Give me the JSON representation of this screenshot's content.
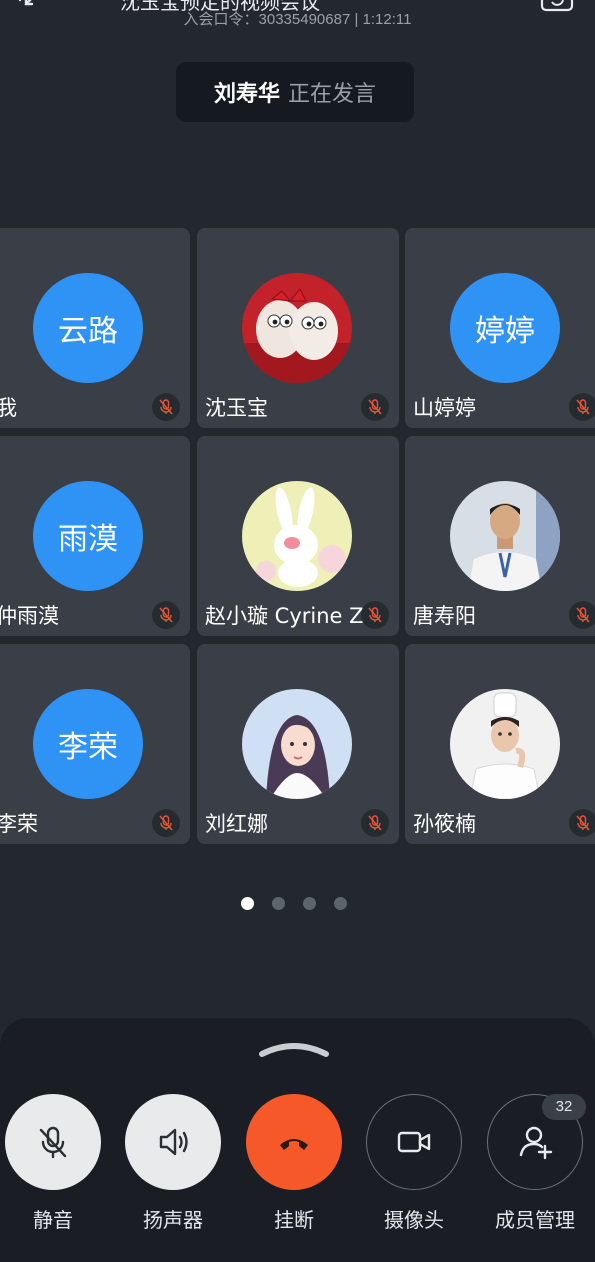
{
  "header": {
    "title_clipped": "沈玉宝预定的视频会议",
    "meeting_code": "入会口令：30335490687 | 1:12:11"
  },
  "speaker": {
    "name": "刘寿华",
    "status": "正在发言"
  },
  "participants": [
    {
      "name": "我",
      "avatar_text": "云路",
      "avatar_type": "text",
      "muted": true
    },
    {
      "name": "沈玉宝",
      "avatar_text": "",
      "avatar_type": "photo-eggs",
      "muted": true
    },
    {
      "name": "山婷婷",
      "avatar_text": "婷婷",
      "avatar_type": "text",
      "muted": true
    },
    {
      "name": "仲雨漠",
      "avatar_text": "雨漠",
      "avatar_type": "text",
      "muted": true
    },
    {
      "name": "赵小璇 Cyrine Z",
      "avatar_text": "",
      "avatar_type": "photo-rabbit",
      "muted": true
    },
    {
      "name": "唐寿阳",
      "avatar_text": "",
      "avatar_type": "photo-chef-man",
      "muted": true
    },
    {
      "name": "李荣",
      "avatar_text": "李荣",
      "avatar_type": "text",
      "muted": true
    },
    {
      "name": "刘红娜",
      "avatar_text": "",
      "avatar_type": "photo-woman",
      "muted": true
    },
    {
      "name": "孙筱楠",
      "avatar_text": "",
      "avatar_type": "photo-chef-woman",
      "muted": true
    }
  ],
  "pager": {
    "pages": 4,
    "current": 1
  },
  "controls": {
    "mute_label": "静音",
    "speaker_label": "扬声器",
    "hangup_label": "挂断",
    "camera_label": "摄像头",
    "members_label": "成员管理",
    "members_count": "32"
  },
  "colors": {
    "background": "#23282f",
    "tile": "#3a3f47",
    "avatar_blue": "#2e93f5",
    "hangup_red": "#f6582a",
    "mute_indicator": "#e8553a"
  },
  "icons": {
    "top_left": "shrink-arrows-icon",
    "top_right": "switch-camera-icon",
    "mute": "mic-off-icon",
    "speaker": "speaker-icon",
    "hangup": "phone-hangup-icon",
    "camera": "video-camera-icon",
    "members": "add-user-icon"
  }
}
